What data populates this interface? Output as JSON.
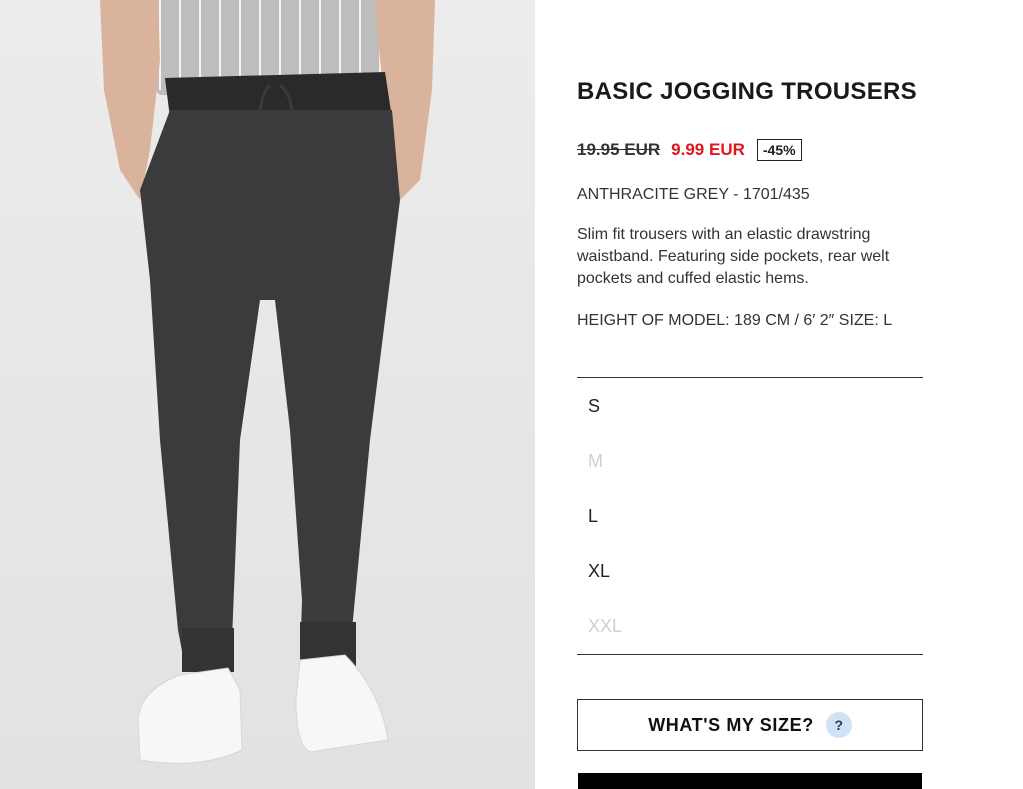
{
  "product": {
    "title": "BASIC JOGGING TROUSERS",
    "old_price": "19.95 EUR",
    "new_price": "9.99 EUR",
    "discount": "-45%",
    "color_ref": "ANTHRACITE GREY - 1701/435",
    "description": "Slim fit trousers with an elastic drawstring waistband. Featuring side pockets, rear welt pockets and cuffed elastic hems.",
    "model_info": "HEIGHT OF MODEL: 189 CM / 6′ 2″ SIZE: L"
  },
  "sizes": [
    {
      "label": "S",
      "available": true
    },
    {
      "label": "M",
      "available": false
    },
    {
      "label": "L",
      "available": true
    },
    {
      "label": "XL",
      "available": true
    },
    {
      "label": "XXL",
      "available": false
    }
  ],
  "whats_my_size": {
    "label": "WHAT'S MY SIZE?",
    "help": "?"
  },
  "colors": {
    "sale_red": "#e0161a",
    "help_badge": "#cfe3f4",
    "unavailable": "#cfcfcf"
  }
}
